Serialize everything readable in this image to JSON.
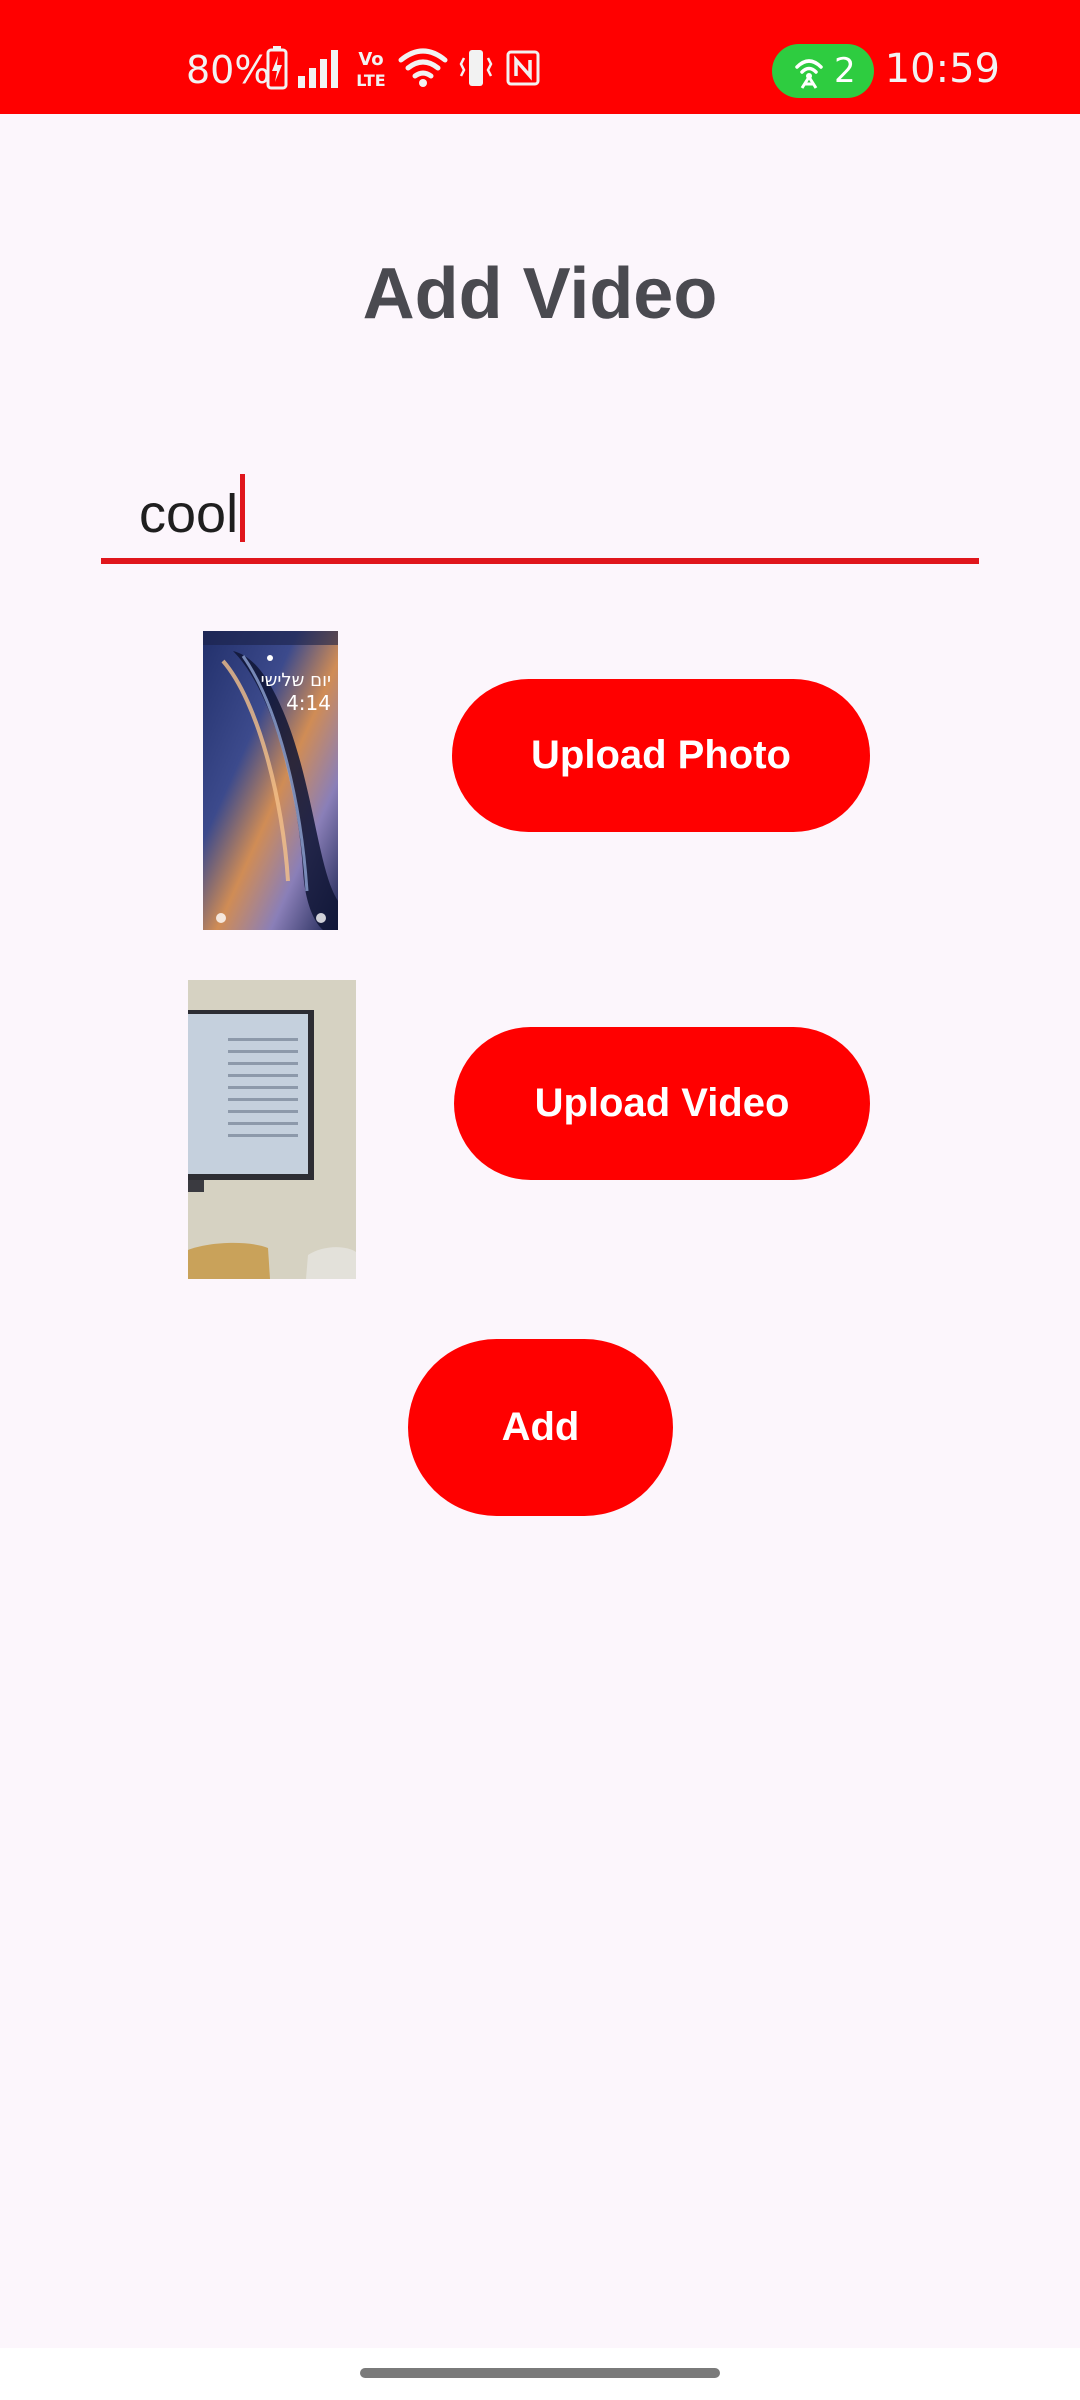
{
  "status_bar": {
    "battery_percent": "80%",
    "time": "10:59",
    "hotspot_count": "2",
    "icons": [
      "battery-charging-icon",
      "signal-icon",
      "volte-icon",
      "wifi-icon",
      "vibrate-icon",
      "nfc-icon",
      "hotspot-icon"
    ],
    "background_color": "#FF0000"
  },
  "page": {
    "title": "Add Video",
    "background_color": "#FCF6FC"
  },
  "title_field": {
    "value": "cool",
    "underline_color": "#E0161C"
  },
  "photo_row": {
    "thumbnail": "lock-screen-photo-thumbnail",
    "button_label": "Upload Photo"
  },
  "video_row": {
    "thumbnail": "video-frame-thumbnail",
    "button_label": "Upload Video"
  },
  "submit": {
    "label": "Add"
  },
  "accent_color": "#FF0000"
}
